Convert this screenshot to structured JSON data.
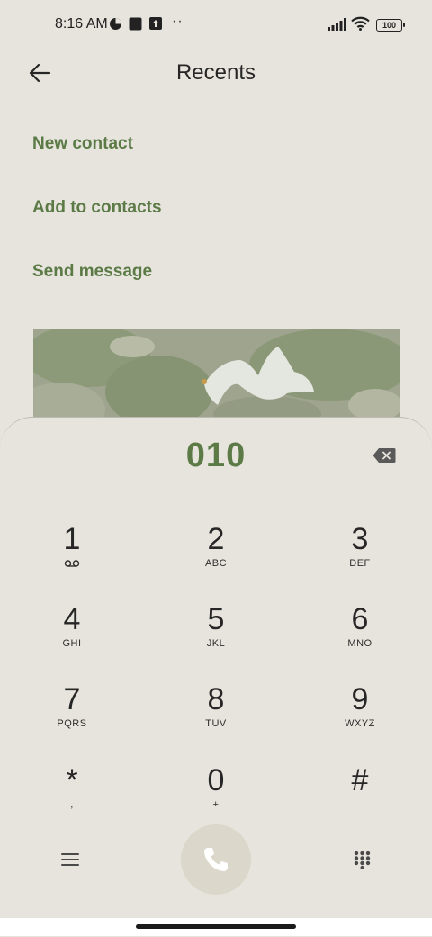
{
  "status_bar": {
    "time": "8:16 AM",
    "battery": "100"
  },
  "header": {
    "title": "Recents"
  },
  "menu": {
    "new_contact": "New contact",
    "add_to_contacts": "Add to contacts",
    "send_message": "Send message"
  },
  "dialer": {
    "number": "010",
    "keys": [
      {
        "digit": "1",
        "letters": ""
      },
      {
        "digit": "2",
        "letters": "ABC"
      },
      {
        "digit": "3",
        "letters": "DEF"
      },
      {
        "digit": "4",
        "letters": "GHI"
      },
      {
        "digit": "5",
        "letters": "JKL"
      },
      {
        "digit": "6",
        "letters": "MNO"
      },
      {
        "digit": "7",
        "letters": "PQRS"
      },
      {
        "digit": "8",
        "letters": "TUV"
      },
      {
        "digit": "9",
        "letters": "WXYZ"
      },
      {
        "digit": "*",
        "letters": ","
      },
      {
        "digit": "0",
        "letters": "+"
      },
      {
        "digit": "#",
        "letters": ""
      }
    ]
  },
  "colors": {
    "accent": "#5b7a46",
    "background": "#e6e4dc",
    "call_button": "#dcd7cb"
  },
  "icons": [
    "back-arrow-icon",
    "backspace-icon",
    "voicemail-icon",
    "menu-icon",
    "phone-icon",
    "dialpad-icon",
    "wifi-icon",
    "signal-icon"
  ]
}
